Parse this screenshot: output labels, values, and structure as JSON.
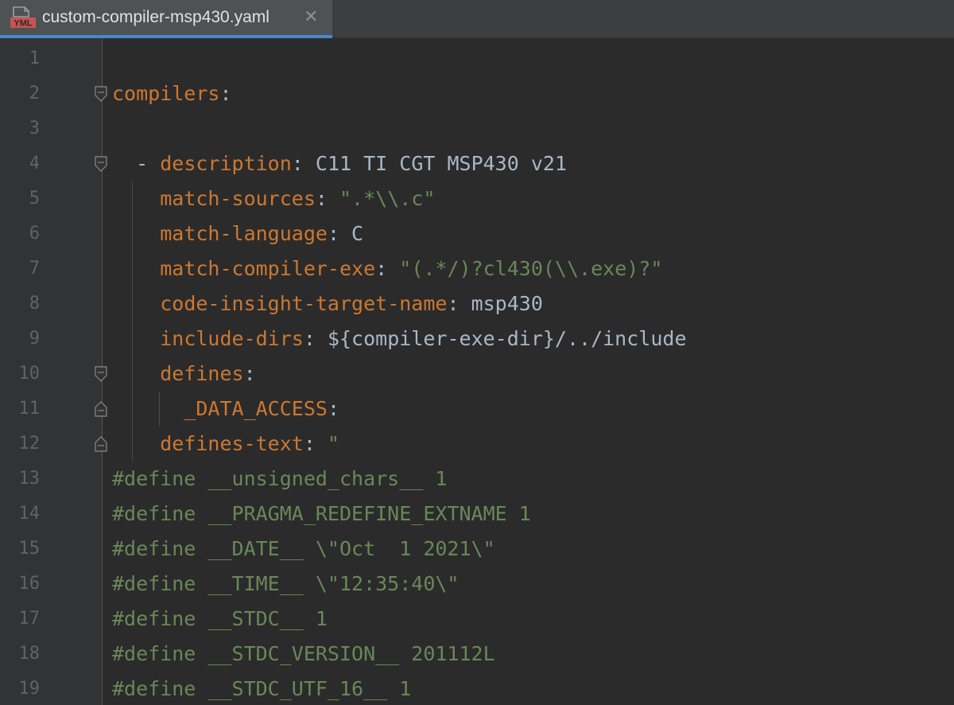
{
  "tab": {
    "icon_label": "YML",
    "title": "custom-compiler-msp430.yaml",
    "close_glyph": "✕"
  },
  "colors": {
    "background": "#2b2b2b",
    "key": "#cc7832",
    "string": "#6a8759",
    "plain": "#a9b7c6",
    "line_number": "#606366",
    "tab_accent": "#4a88c7"
  },
  "editor": {
    "lines": [
      {
        "num": "1",
        "tokens": []
      },
      {
        "num": "2",
        "tokens": [
          {
            "t": "compilers",
            "c": "k"
          },
          {
            "t": ":",
            "c": "p"
          }
        ]
      },
      {
        "num": "3",
        "tokens": []
      },
      {
        "num": "4",
        "tokens": [
          {
            "t": "  - ",
            "c": "p"
          },
          {
            "t": "description",
            "c": "k"
          },
          {
            "t": ": ",
            "c": "p"
          },
          {
            "t": "C11 TI CGT MSP430 v21",
            "c": "p"
          }
        ]
      },
      {
        "num": "5",
        "tokens": [
          {
            "t": "    ",
            "c": "p"
          },
          {
            "t": "match-sources",
            "c": "k"
          },
          {
            "t": ": ",
            "c": "p"
          },
          {
            "t": "\".*\\\\.c\"",
            "c": "s"
          }
        ]
      },
      {
        "num": "6",
        "tokens": [
          {
            "t": "    ",
            "c": "p"
          },
          {
            "t": "match-language",
            "c": "k"
          },
          {
            "t": ": ",
            "c": "p"
          },
          {
            "t": "C",
            "c": "p"
          }
        ]
      },
      {
        "num": "7",
        "tokens": [
          {
            "t": "    ",
            "c": "p"
          },
          {
            "t": "match-compiler-exe",
            "c": "k"
          },
          {
            "t": ": ",
            "c": "p"
          },
          {
            "t": "\"(.*/)?cl430(\\\\.exe)?\"",
            "c": "s"
          }
        ]
      },
      {
        "num": "8",
        "tokens": [
          {
            "t": "    ",
            "c": "p"
          },
          {
            "t": "code-insight-target-name",
            "c": "k"
          },
          {
            "t": ": ",
            "c": "p"
          },
          {
            "t": "msp430",
            "c": "p"
          }
        ]
      },
      {
        "num": "9",
        "tokens": [
          {
            "t": "    ",
            "c": "p"
          },
          {
            "t": "include-dirs",
            "c": "k"
          },
          {
            "t": ": ",
            "c": "p"
          },
          {
            "t": "${compiler-exe-dir}/../include",
            "c": "p"
          }
        ]
      },
      {
        "num": "10",
        "tokens": [
          {
            "t": "    ",
            "c": "p"
          },
          {
            "t": "defines",
            "c": "k"
          },
          {
            "t": ":",
            "c": "p"
          }
        ]
      },
      {
        "num": "11",
        "tokens": [
          {
            "t": "      ",
            "c": "p"
          },
          {
            "t": "_DATA_ACCESS",
            "c": "k"
          },
          {
            "t": ":",
            "c": "p"
          }
        ]
      },
      {
        "num": "12",
        "tokens": [
          {
            "t": "    ",
            "c": "p"
          },
          {
            "t": "defines-text",
            "c": "k"
          },
          {
            "t": ": ",
            "c": "p"
          },
          {
            "t": "\"",
            "c": "s"
          }
        ]
      },
      {
        "num": "13",
        "tokens": [
          {
            "t": "#define __unsigned_chars__ 1",
            "c": "s"
          }
        ]
      },
      {
        "num": "14",
        "tokens": [
          {
            "t": "#define __PRAGMA_REDEFINE_EXTNAME 1",
            "c": "s"
          }
        ]
      },
      {
        "num": "15",
        "tokens": [
          {
            "t": "#define __DATE__ \\\"Oct  1 2021\\\"",
            "c": "s"
          }
        ]
      },
      {
        "num": "16",
        "tokens": [
          {
            "t": "#define __TIME__ \\\"12:35:40\\\"",
            "c": "s"
          }
        ]
      },
      {
        "num": "17",
        "tokens": [
          {
            "t": "#define __STDC__ 1",
            "c": "s"
          }
        ]
      },
      {
        "num": "18",
        "tokens": [
          {
            "t": "#define __STDC_VERSION__ 201112L",
            "c": "s"
          }
        ]
      },
      {
        "num": "19",
        "tokens": [
          {
            "t": "#define __STDC_UTF_16__ 1",
            "c": "s"
          }
        ]
      }
    ]
  }
}
